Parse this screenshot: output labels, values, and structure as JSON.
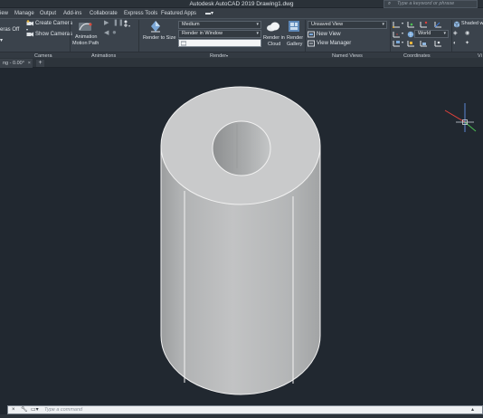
{
  "window": {
    "title": "Autodesk AutoCAD 2019    Drawing1.dwg",
    "search_placeholder": "Type a keyword or phrase"
  },
  "menu": {
    "tabs": [
      "iew",
      "Manage",
      "Output",
      "Add-ins",
      "Collaborate",
      "Express Tools",
      "Featured Apps"
    ]
  },
  "ribbon": {
    "camera": {
      "cameras_off_label": "eras Off",
      "create_camera": "Create Camera",
      "show_cameras": "Show Cameras",
      "panel_label": "Camera"
    },
    "animations": {
      "motion_path_label_1": "Animation",
      "motion_path_label_2": "Motion Path",
      "panel_label": "Animations"
    },
    "render": {
      "render_to_size_label": "Render to Size",
      "quality_value": "Medium",
      "destination_value": "Render in Window",
      "cloud_label_1": "Render in",
      "cloud_label_2": "Cloud",
      "gallery_label_1": "Render",
      "gallery_label_2": "Gallery",
      "panel_label": "Render"
    },
    "named_views": {
      "current_view_value": "Unsaved View",
      "new_view": "New View",
      "view_manager": "View Manager",
      "panel_label": "Named Views"
    },
    "coordinates": {
      "ucs_value": "World",
      "panel_label": "Coordinates"
    },
    "visual_style": {
      "style_value": "Shaded wit",
      "panel_label": "Vi"
    }
  },
  "file_tabs": {
    "active_tab": "ng - 0.00°",
    "close_glyph": "×",
    "new_tab_glyph": "+"
  },
  "command_line": {
    "prompt": "Type a command",
    "close_glyph": "×"
  },
  "colors": {
    "viewport_bg": "#212830",
    "ribbon_bg": "#3b434c",
    "cylinder_face": "#b5b7b8",
    "cylinder_top": "#c9cacb",
    "edge": "#f2f2f2",
    "ucs_x": "#e0413b",
    "ucs_y": "#4cbf52",
    "ucs_z": "#3b78d8"
  }
}
